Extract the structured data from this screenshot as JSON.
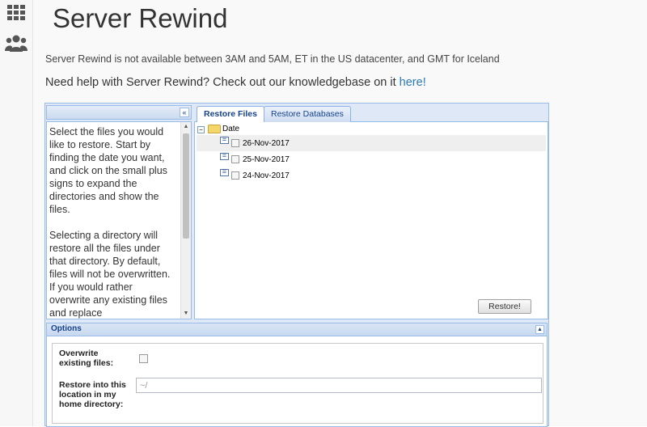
{
  "sidebar": {
    "icons": [
      "grid-icon",
      "users-icon"
    ]
  },
  "page": {
    "title": "Server Rewind",
    "notice": "Server Rewind is not available between 3AM and 5AM, ET in the US datacenter, and GMT for Iceland",
    "help_text": "Need help with Server Rewind? Check out our knowledgebase on it ",
    "help_link": "here!"
  },
  "west_panel": {
    "collapse_glyph": "«",
    "paragraphs": [
      "Select the files you would like to restore. Start by finding the date you want, and click on the small plus signs to expand the directories and show the files.",
      "Selecting a directory will restore all the files under that directory. By default, files will not be overwritten. If you would rather overwrite any existing files and replace"
    ]
  },
  "tabs": [
    {
      "label": "Restore Files",
      "active": true
    },
    {
      "label": "Restore Databases",
      "active": false
    }
  ],
  "tree": {
    "root_label": "Date",
    "dates": [
      "26-Nov-2017",
      "25-Nov-2017",
      "24-Nov-2017"
    ],
    "selected_index": 0
  },
  "restore_button": "Restore!",
  "options": {
    "title": "Options",
    "overwrite_label": "Overwrite existing files:",
    "overwrite_checked": false,
    "restore_location_label": "Restore into this location in my home directory:",
    "restore_location_value": "~/"
  }
}
